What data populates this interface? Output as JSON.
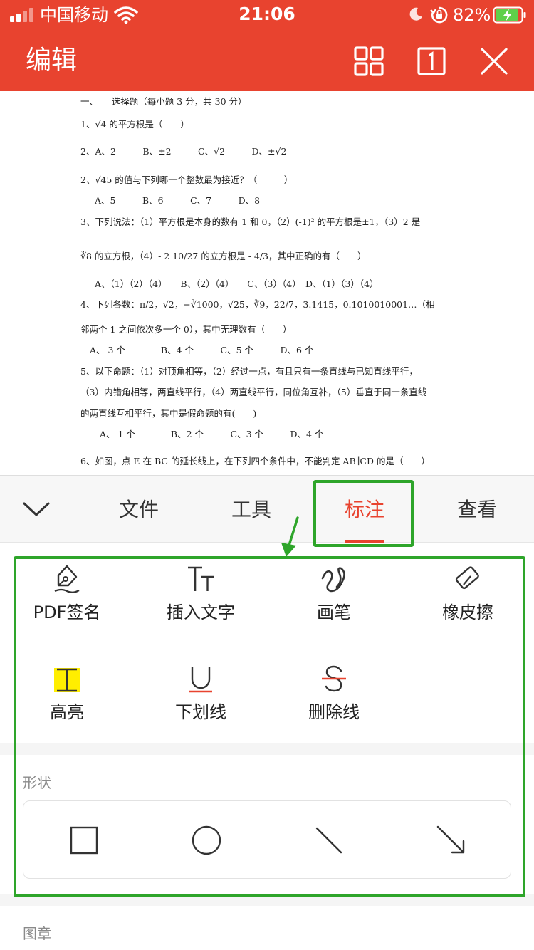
{
  "status_bar": {
    "carrier": "中国移动",
    "time": "21:06",
    "battery": "82%"
  },
  "header": {
    "title": "编辑"
  },
  "document": {
    "lines": [
      "一、　　选择题（每小题 3 分，共 30 分）",
      "1、√4 的平方根是（　　）",
      "2、A、2　　　B、±2　　　C、√2　　　D、±√2",
      "2、√45 的值与下列哪一个整数最为接近？（　　　）",
      "A、5　　　B、6　　　C、7　　　D、8",
      "3、下列说法：（1）平方根是本身的数有 1 和 0，（2）(-1)² 的平方根是±1，（3）2 是",
      "∛8 的立方根，（4）- 2 10/27 的立方根是 - 4/3，其中正确的有（　　）",
      "A、（1）（2）（4）　　B、（2）（4）　　C、（3）（4）　D、（1）（3）（4）",
      "4、下列各数：π/2，√2，−∛1000，√25，∛9，22/7，3.1415，0.1010010001…（相",
      "邻两个 1 之间依次多一个 0），其中无理数有（　　）",
      "A、 3 个　　　　B、4 个　　　C、5 个　　　D、6 个",
      "5、以下命题：（1）对顶角相等，（2）经过一点，有且只有一条直线与已知直线平行，",
      "（3）内错角相等，两直线平行，（4）两直线平行，同位角互补，（5）垂直于同一条直线",
      "的两直线互相平行，其中是假命题的有(　　)",
      "A、 1 个　　　　B、2 个　　　C、3 个　　　D、4 个",
      "6、如图，点 E 在 BC 的延长线上，在下列四个条件中，不能判定 AB∥CD 的是（　　）"
    ]
  },
  "tabs": [
    {
      "label": "文件"
    },
    {
      "label": "工具"
    },
    {
      "label": "标注"
    },
    {
      "label": "查看"
    }
  ],
  "tools": [
    {
      "label": "PDF签名",
      "icon": "pen-sign-icon"
    },
    {
      "label": "插入文字",
      "icon": "text-size-icon"
    },
    {
      "label": "画笔",
      "icon": "brush-icon"
    },
    {
      "label": "橡皮擦",
      "icon": "eraser-icon"
    },
    {
      "label": "高亮",
      "icon": "highlight-icon"
    },
    {
      "label": "下划线",
      "icon": "underline-icon"
    },
    {
      "label": "删除线",
      "icon": "strikethrough-icon"
    }
  ],
  "sections": {
    "shapes": "形状",
    "stamps": "图章"
  },
  "colors": {
    "accent": "#e8432f",
    "annotation_green": "#2ea52a",
    "highlight_yellow": "#ffee00"
  }
}
